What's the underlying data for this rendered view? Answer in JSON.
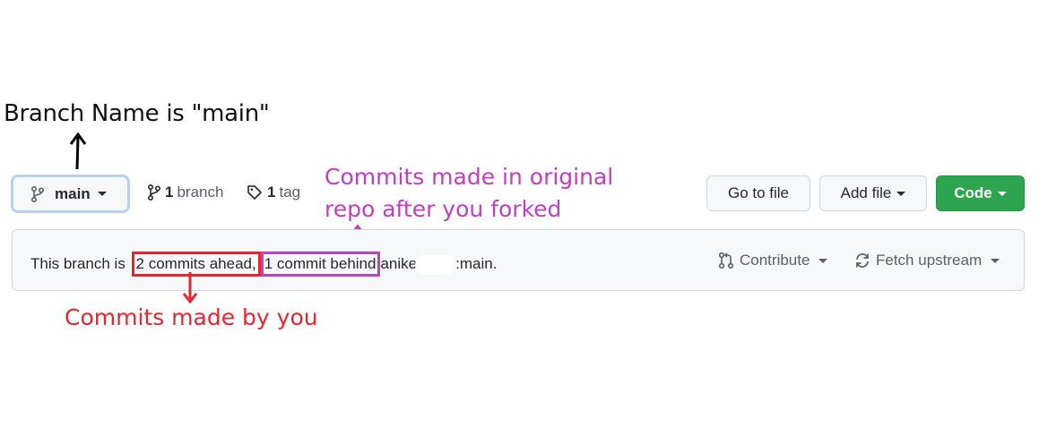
{
  "annotations": {
    "branch_name": "Branch Name is \"main\"",
    "upstream_line1": "Commits made in original",
    "upstream_line2": "repo after you forked",
    "yours": "Commits made by you"
  },
  "branch_selector": {
    "label": "main",
    "icon": "git-branch-icon"
  },
  "branches": {
    "count": "1",
    "label": "branch",
    "icon": "git-branch-icon"
  },
  "tags": {
    "count": "1",
    "label": "tag",
    "icon": "tag-icon"
  },
  "buttons": {
    "go_to_file": "Go to file",
    "add_file": "Add file",
    "code": "Code"
  },
  "status": {
    "prefix": "This branch is",
    "ahead": "2 commits ahead,",
    "behind": "1 commit behind",
    "upstream_owner": "anike",
    "upstream_branch": ":main."
  },
  "actions": {
    "contribute": "Contribute",
    "fetch_upstream": "Fetch upstream"
  },
  "colors": {
    "upstream_annotation": "#bf3fc0",
    "yours_annotation": "#e8242f",
    "code_button": "#2da44e",
    "focus_ring": "#b6d0ee"
  }
}
